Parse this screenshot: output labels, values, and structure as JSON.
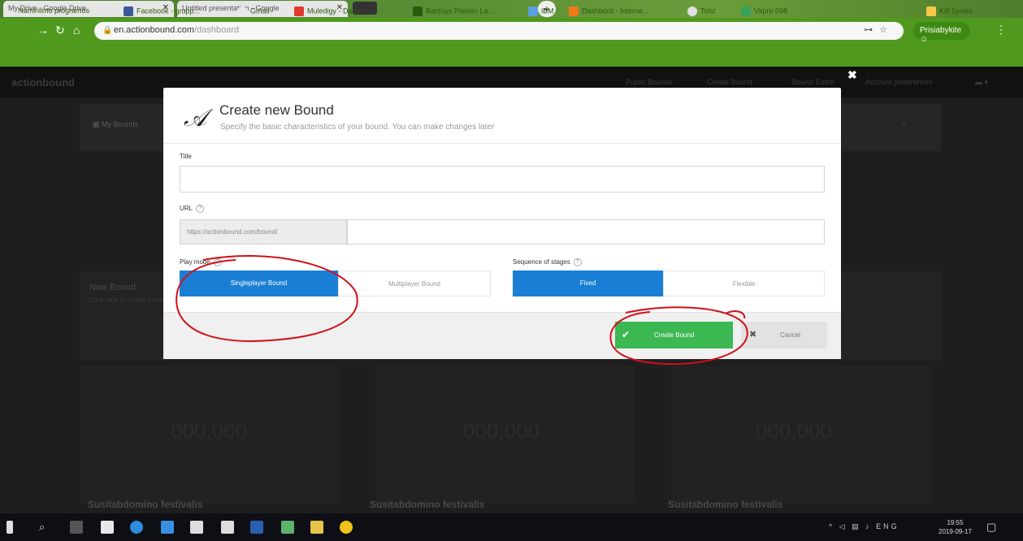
{
  "browser": {
    "tabs": [
      {
        "label": "My Drive - Google Drive"
      },
      {
        "label": "Untitled presentation - Google"
      }
    ],
    "url_host": "en.actionbound.com",
    "url_path": "/dashboard",
    "profile_label": "Prisiabykite",
    "bookmarks": [
      {
        "label": "Naminiimo programos",
        "color": "#1e6fd9"
      },
      {
        "label": "Facebook - grupp...",
        "color": "#3b5998"
      },
      {
        "label": "Gmail",
        "color": "#d9d9d9"
      },
      {
        "label": "Muledigy - Da.pr...",
        "color": "#e03a2e"
      },
      {
        "label": "Barzuys Premm La...",
        "color": "#2a5a0c"
      },
      {
        "label": "iBM",
        "color": "#5a9fe0"
      },
      {
        "label": "Dashbord - Interne...",
        "color": "#f07a1a"
      },
      {
        "label": "Tolst",
        "color": "#e0e0e0"
      },
      {
        "label": "Vkpro 098",
        "color": "#39a35a"
      },
      {
        "label": "Kiti žymės",
        "color": "#f7c948"
      }
    ]
  },
  "app": {
    "logo": "actionbound",
    "nav": [
      "Public Bounds",
      "Create Bound",
      "Bound Editor",
      "Account preferences"
    ],
    "breadcrumb": "My Bounds",
    "card_title": "New Bound",
    "card_sub": "Click here to create a new bound",
    "stats": [
      "000,000",
      "000,000",
      "000,000"
    ],
    "footer_titles": [
      "Susitabdomino festivalis",
      "Susitabdomino festivalis",
      "Susitabdomino festivalis"
    ]
  },
  "modal": {
    "title": "Create new Bound",
    "subtitle": "Specify the basic characteristics of your bound. You can make changes later",
    "title_label": "Title",
    "title_value": "",
    "url_label": "URL",
    "url_prefix": "https://actionbound.com/bound/",
    "url_value": "",
    "play_mode_label": "Play mode",
    "play_modes": [
      "Singleplayer Bound",
      "Multiplayer Bound"
    ],
    "play_mode_selected": "Singleplayer Bound",
    "sequence_label": "Sequence of stages",
    "sequences": [
      "Fixed",
      "Flexible"
    ],
    "sequence_selected": "Fixed",
    "create_button": "Create Bound",
    "cancel_button": "Cancel"
  },
  "taskbar": {
    "lang": "ENG",
    "time": "19:55",
    "date": "2019-09-17"
  },
  "colors": {
    "accent_blue": "#1a7fd4",
    "create_green": "#3cb853",
    "annotation_red": "#d0101a",
    "chrome_green": "#4f9a1e"
  }
}
